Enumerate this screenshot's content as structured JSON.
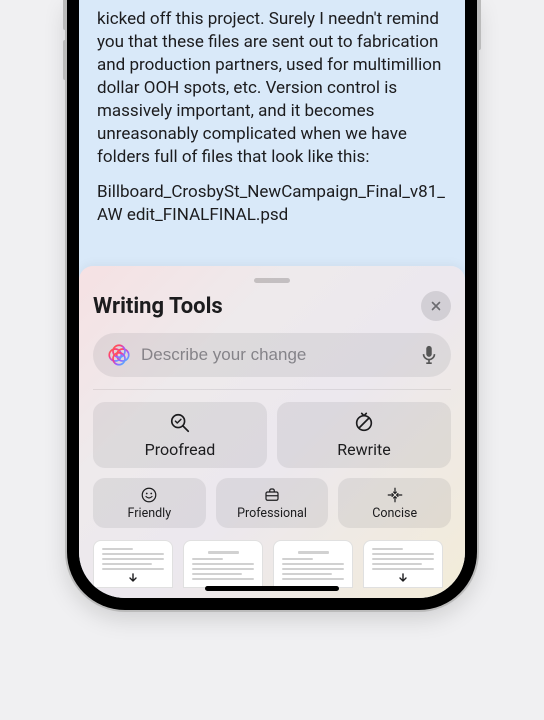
{
  "note": {
    "paragraph1": "kicked off this project. Surely I needn't remind you that these files are sent out to fabrication and production partners, used for multimillion dollar OOH spots, etc. Version control is massively important, and it becomes unreasonably complicated when we have folders full of files that look like this:",
    "filename": "Billboard_CrosbySt_NewCampaign_Final_v81_AW edit_FINALFINAL.psd"
  },
  "sheet": {
    "title": "Writing Tools",
    "input_placeholder": "Describe your change",
    "actions": {
      "proofread": "Proofread",
      "rewrite": "Rewrite",
      "friendly": "Friendly",
      "professional": "Professional",
      "concise": "Concise"
    }
  }
}
